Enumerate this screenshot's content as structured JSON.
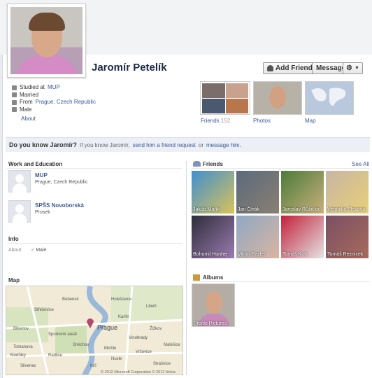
{
  "profile": {
    "name": "Jaromír Petelík"
  },
  "actions": {
    "add_friend": "Add Friend",
    "message": "Message"
  },
  "info": [
    {
      "icon": "school-icon",
      "text": "Studied at ",
      "link": "MUP"
    },
    {
      "icon": "heart-icon",
      "text": "Married",
      "link": ""
    },
    {
      "icon": "home-icon",
      "text": "From ",
      "link": "Prague, Czech Republic"
    },
    {
      "icon": "male-icon",
      "text": "Male",
      "link": ""
    }
  ],
  "about_link": "About",
  "tiles": {
    "friends_label": "Friends",
    "friends_count": "152",
    "photos_label": "Photos",
    "map_label": "Map"
  },
  "know": {
    "title": "Do you know Jaromír?",
    "prefix": "If you know Jaromír,",
    "link1": "send him a friend request",
    "mid": "or",
    "link2": "message him",
    "suffix": "."
  },
  "work": {
    "title": "Work and Education",
    "items": [
      {
        "name": "MUP",
        "sub": "Prague, Czech Republic"
      },
      {
        "name": "SPŠS Novoborská",
        "sub": "Prosek"
      }
    ]
  },
  "info_section": {
    "title": "Info",
    "label": "About",
    "value": "Male"
  },
  "map_section": {
    "title": "Map",
    "city": "Prague",
    "copyright": "© 2012 Microsoft Corporation  © 2012 Nokia",
    "labels": [
      "Holešovice",
      "Libeň",
      "Karlín",
      "Střešovice",
      "Bubeneč",
      "Břevnov",
      "Smíchov",
      "Vinohrady",
      "Žižkov",
      "Vršovice",
      "Nusle",
      "Malešice",
      "Strašnice",
      "Michle",
      "Krč",
      "Slivenec",
      "Tomanova",
      "Radlice",
      "Stodůlky",
      "Sportovní areál"
    ]
  },
  "friends": {
    "title": "Friends",
    "see_all": "See All",
    "people": [
      "Jakub Mařík",
      "Jan Čihák",
      "Jaroslav Růžička",
      "Veronika Plevová",
      "Bohumil Hunhej",
      "Viktor Pazler",
      "Tomáš Kott",
      "Tomáš Reznicek"
    ]
  },
  "albums": {
    "title": "Albums",
    "items": [
      "Profile Pictures"
    ]
  },
  "colors": {
    "link": "#3b5998",
    "header_bg": "#eceff5"
  }
}
